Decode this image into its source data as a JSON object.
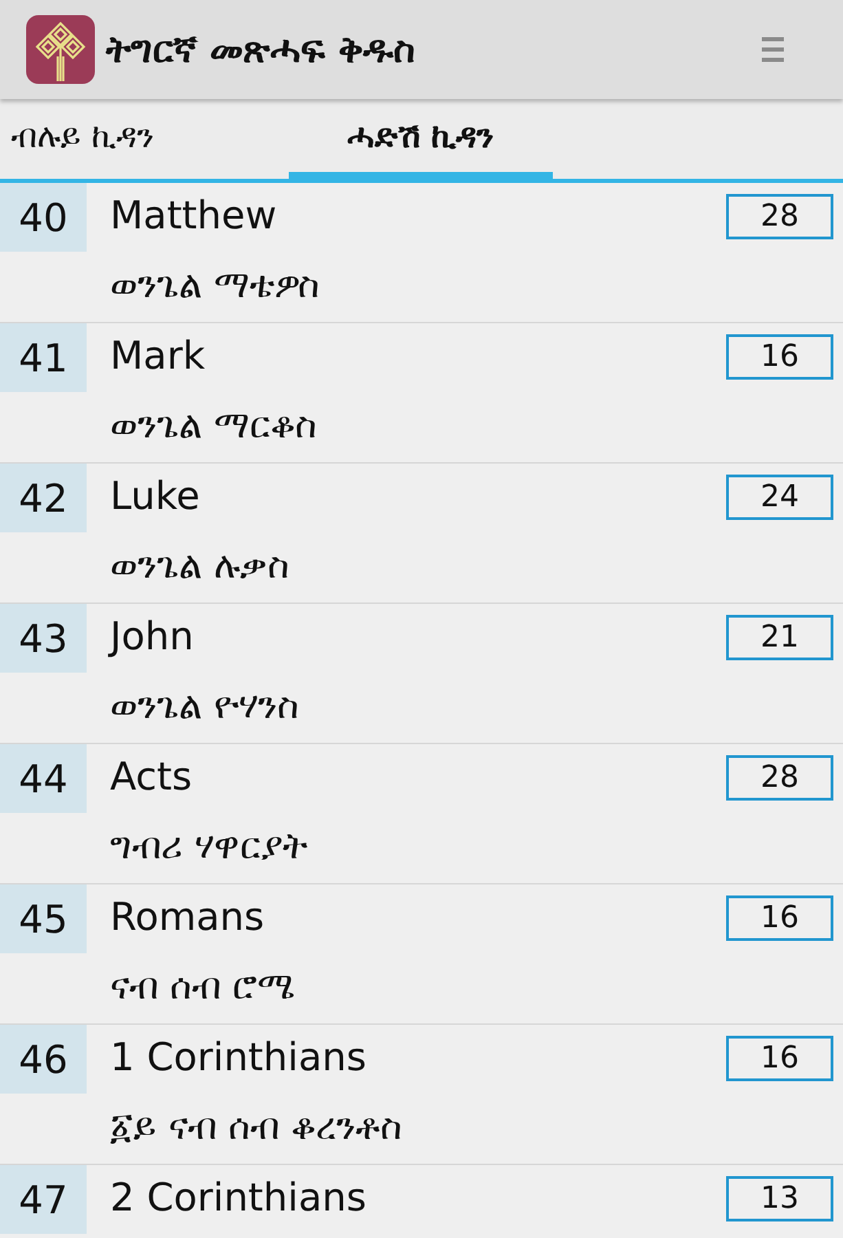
{
  "app_bar": {
    "title": "ትግርኛ መጽሓፍ ቅዱስ"
  },
  "tabs": [
    {
      "label": "ብሉይ ኪዳን",
      "selected": false
    },
    {
      "label": "ሓድሽ ኪዳን",
      "selected": true
    }
  ],
  "books": [
    {
      "number": "40",
      "name": "Matthew",
      "chapters": "28",
      "tigrinya": "ወንጌል ማቴዎስ"
    },
    {
      "number": "41",
      "name": "Mark",
      "chapters": "16",
      "tigrinya": "ወንጌል ማርቆስ"
    },
    {
      "number": "42",
      "name": "Luke",
      "chapters": "24",
      "tigrinya": "ወንጌል ሉቃስ"
    },
    {
      "number": "43",
      "name": "John",
      "chapters": "21",
      "tigrinya": "ወንጌል ዮሃንስ"
    },
    {
      "number": "44",
      "name": "Acts",
      "chapters": "28",
      "tigrinya": "ግብሪ ሃዋርያት"
    },
    {
      "number": "45",
      "name": "Romans",
      "chapters": "16",
      "tigrinya": "ናብ ሰብ ሮሜ"
    },
    {
      "number": "46",
      "name": "1 Corinthians",
      "chapters": "16",
      "tigrinya": "፩ይ ናብ ሰብ ቆረንቶስ"
    },
    {
      "number": "47",
      "name": "2 Corinthians",
      "chapters": "13"
    }
  ]
}
